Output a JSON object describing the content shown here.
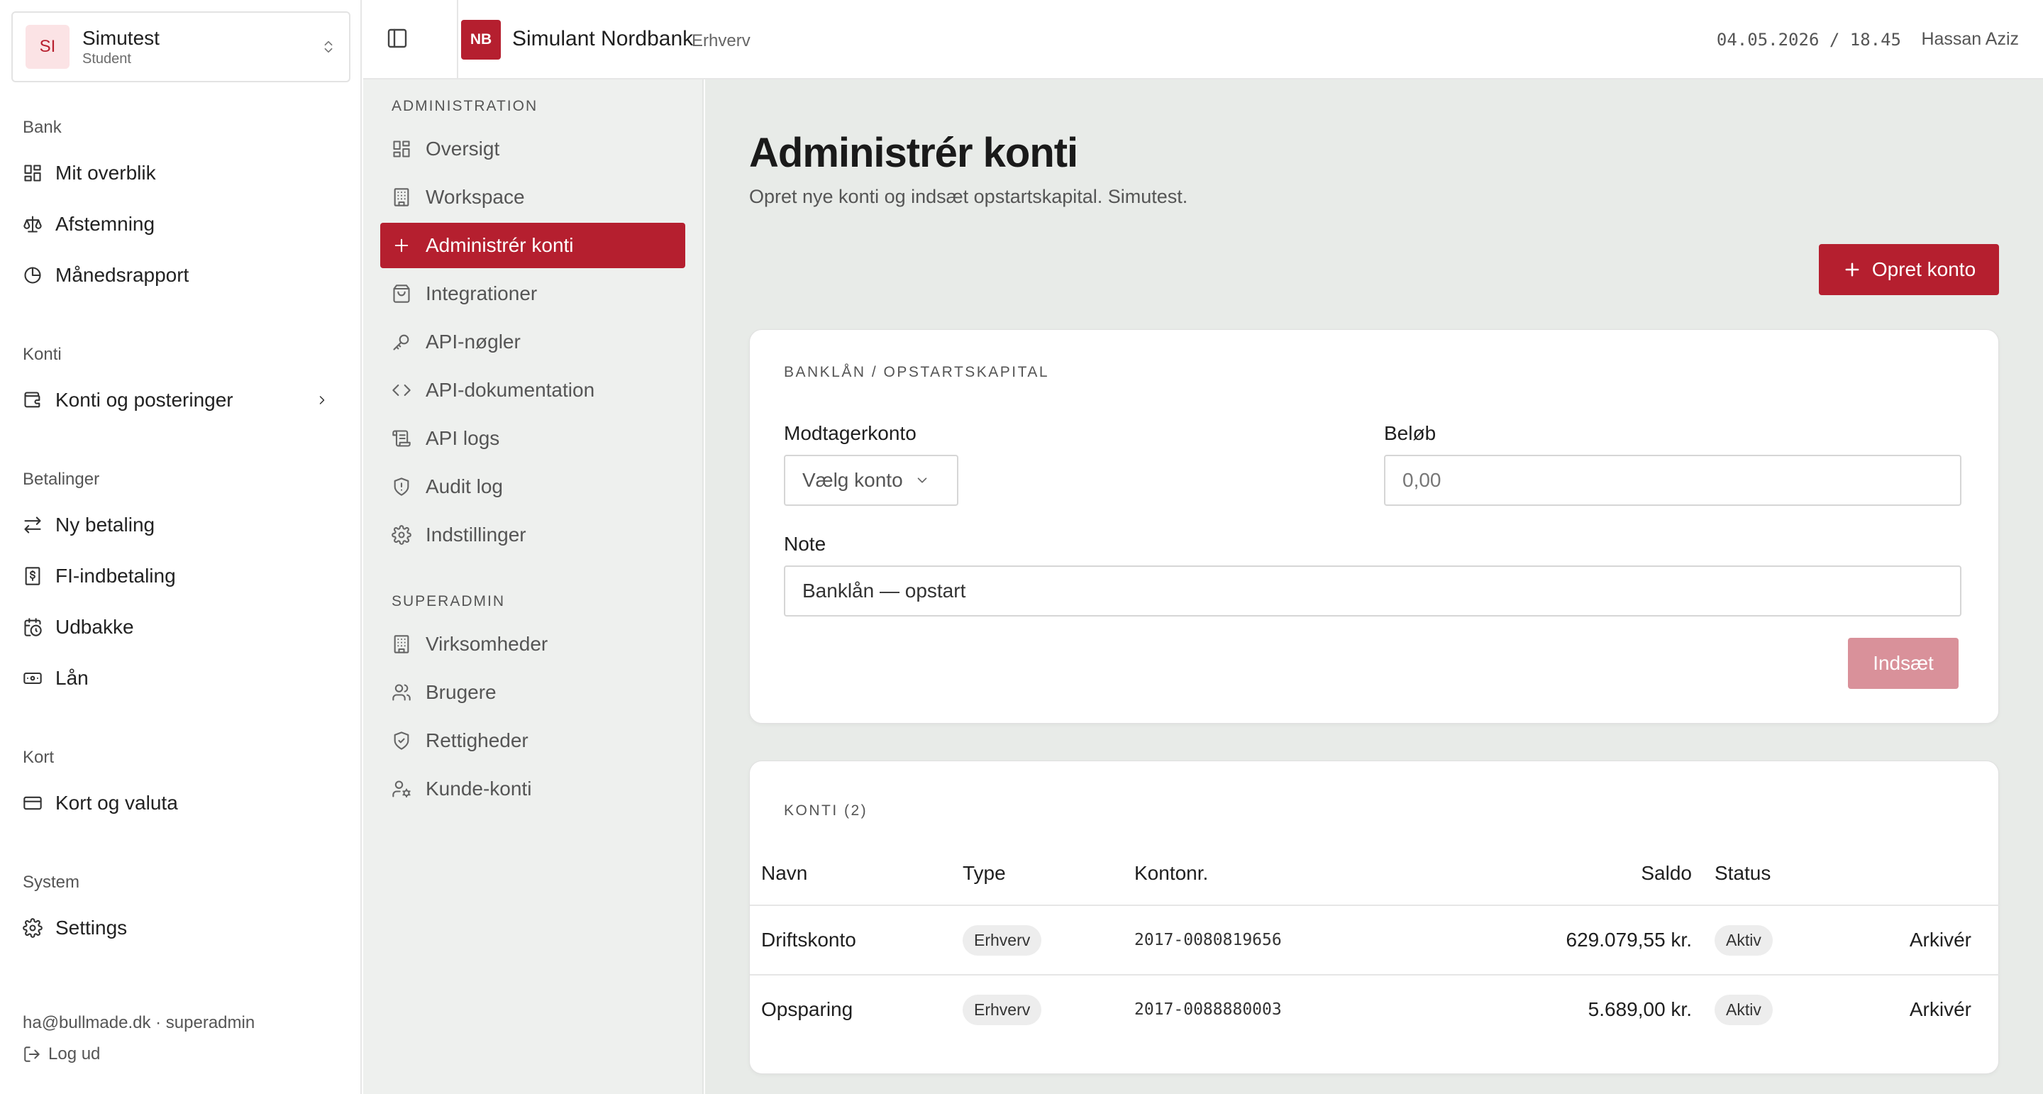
{
  "colors": {
    "accent": "#b51f2f",
    "accent_disabled": "#d9919a",
    "main_bg": "#e8ebe8",
    "nav_bg": "#eef0ee"
  },
  "org": {
    "avatar": "SI",
    "name": "Simutest",
    "role": "Student"
  },
  "sidebar": {
    "sections": [
      {
        "title": "Bank",
        "items": [
          {
            "label": "Mit overblik",
            "icon": "dashboard-icon"
          },
          {
            "label": "Afstemning",
            "icon": "scale-icon"
          },
          {
            "label": "Månedsrapport",
            "icon": "pie-chart-icon"
          }
        ]
      },
      {
        "title": "Konti",
        "items": [
          {
            "label": "Konti og posteringer",
            "icon": "wallet-icon"
          }
        ]
      },
      {
        "title": "Betalinger",
        "items": [
          {
            "label": "Ny betaling",
            "icon": "transfer-icon"
          },
          {
            "label": "FI-indbetaling",
            "icon": "receipt-icon"
          },
          {
            "label": "Udbakke",
            "icon": "calendar-clock-icon"
          },
          {
            "label": "Lån",
            "icon": "banknote-icon"
          }
        ]
      },
      {
        "title": "Kort",
        "items": [
          {
            "label": "Kort og valuta",
            "icon": "credit-card-icon"
          }
        ]
      },
      {
        "title": "System",
        "items": [
          {
            "label": "Settings",
            "icon": "gear-icon"
          }
        ]
      }
    ],
    "account_line": "ha@bullmade.dk · superadmin",
    "logout_label": "Log ud"
  },
  "admin_nav": {
    "sections": [
      {
        "title": "ADMINISTRATION",
        "items": [
          {
            "label": "Oversigt",
            "icon": "dashboard-icon"
          },
          {
            "label": "Workspace",
            "icon": "building-icon"
          },
          {
            "label": "Administrér konti",
            "icon": "plus-icon",
            "active": true
          },
          {
            "label": "Integrationer",
            "icon": "package-icon"
          },
          {
            "label": "API-nøgler",
            "icon": "key-icon"
          },
          {
            "label": "API-dokumentation",
            "icon": "code-icon"
          },
          {
            "label": "API logs",
            "icon": "scroll-icon"
          },
          {
            "label": "Audit log",
            "icon": "shield-alert-icon"
          },
          {
            "label": "Indstillinger",
            "icon": "gear-icon"
          }
        ]
      },
      {
        "title": "SUPERADMIN",
        "items": [
          {
            "label": "Virksomheder",
            "icon": "building-icon"
          },
          {
            "label": "Brugere",
            "icon": "users-icon"
          },
          {
            "label": "Rettigheder",
            "icon": "shield-check-icon"
          },
          {
            "label": "Kunde-konti",
            "icon": "user-cog-icon"
          }
        ]
      }
    ]
  },
  "header": {
    "bank_logo": "NB",
    "bank_name": "Simulant Nordbank",
    "bank_segment": "Erhverv",
    "datetime": "04.05.2026 / 18.45",
    "user": "Hassan Aziz"
  },
  "main": {
    "title": "Administrér konti",
    "subtitle": "Opret nye konti og indsæt opstartskapital. Simutest.",
    "create_button": "Opret konto",
    "deposit_card": {
      "label": "BANKLÅN / OPSTARTSKAPITAL",
      "recipient_label": "Modtagerkonto",
      "recipient_value": "Vælg konto",
      "amount_label": "Beløb",
      "amount_placeholder": "0,00",
      "note_label": "Note",
      "note_value": "Banklån — opstart",
      "submit_label": "Indsæt"
    },
    "accounts_card": {
      "label": "KONTI (2)",
      "columns": {
        "name": "Navn",
        "type": "Type",
        "number": "Kontonr.",
        "balance": "Saldo",
        "status": "Status"
      },
      "rows": [
        {
          "name": "Driftskonto",
          "type": "Erhverv",
          "number": "2017-0080819656",
          "balance": "629.079,55 kr.",
          "status": "Aktiv",
          "action": "Arkivér"
        },
        {
          "name": "Opsparing",
          "type": "Erhverv",
          "number": "2017-0088880003",
          "balance": "5.689,00 kr.",
          "status": "Aktiv",
          "action": "Arkivér"
        }
      ]
    }
  }
}
